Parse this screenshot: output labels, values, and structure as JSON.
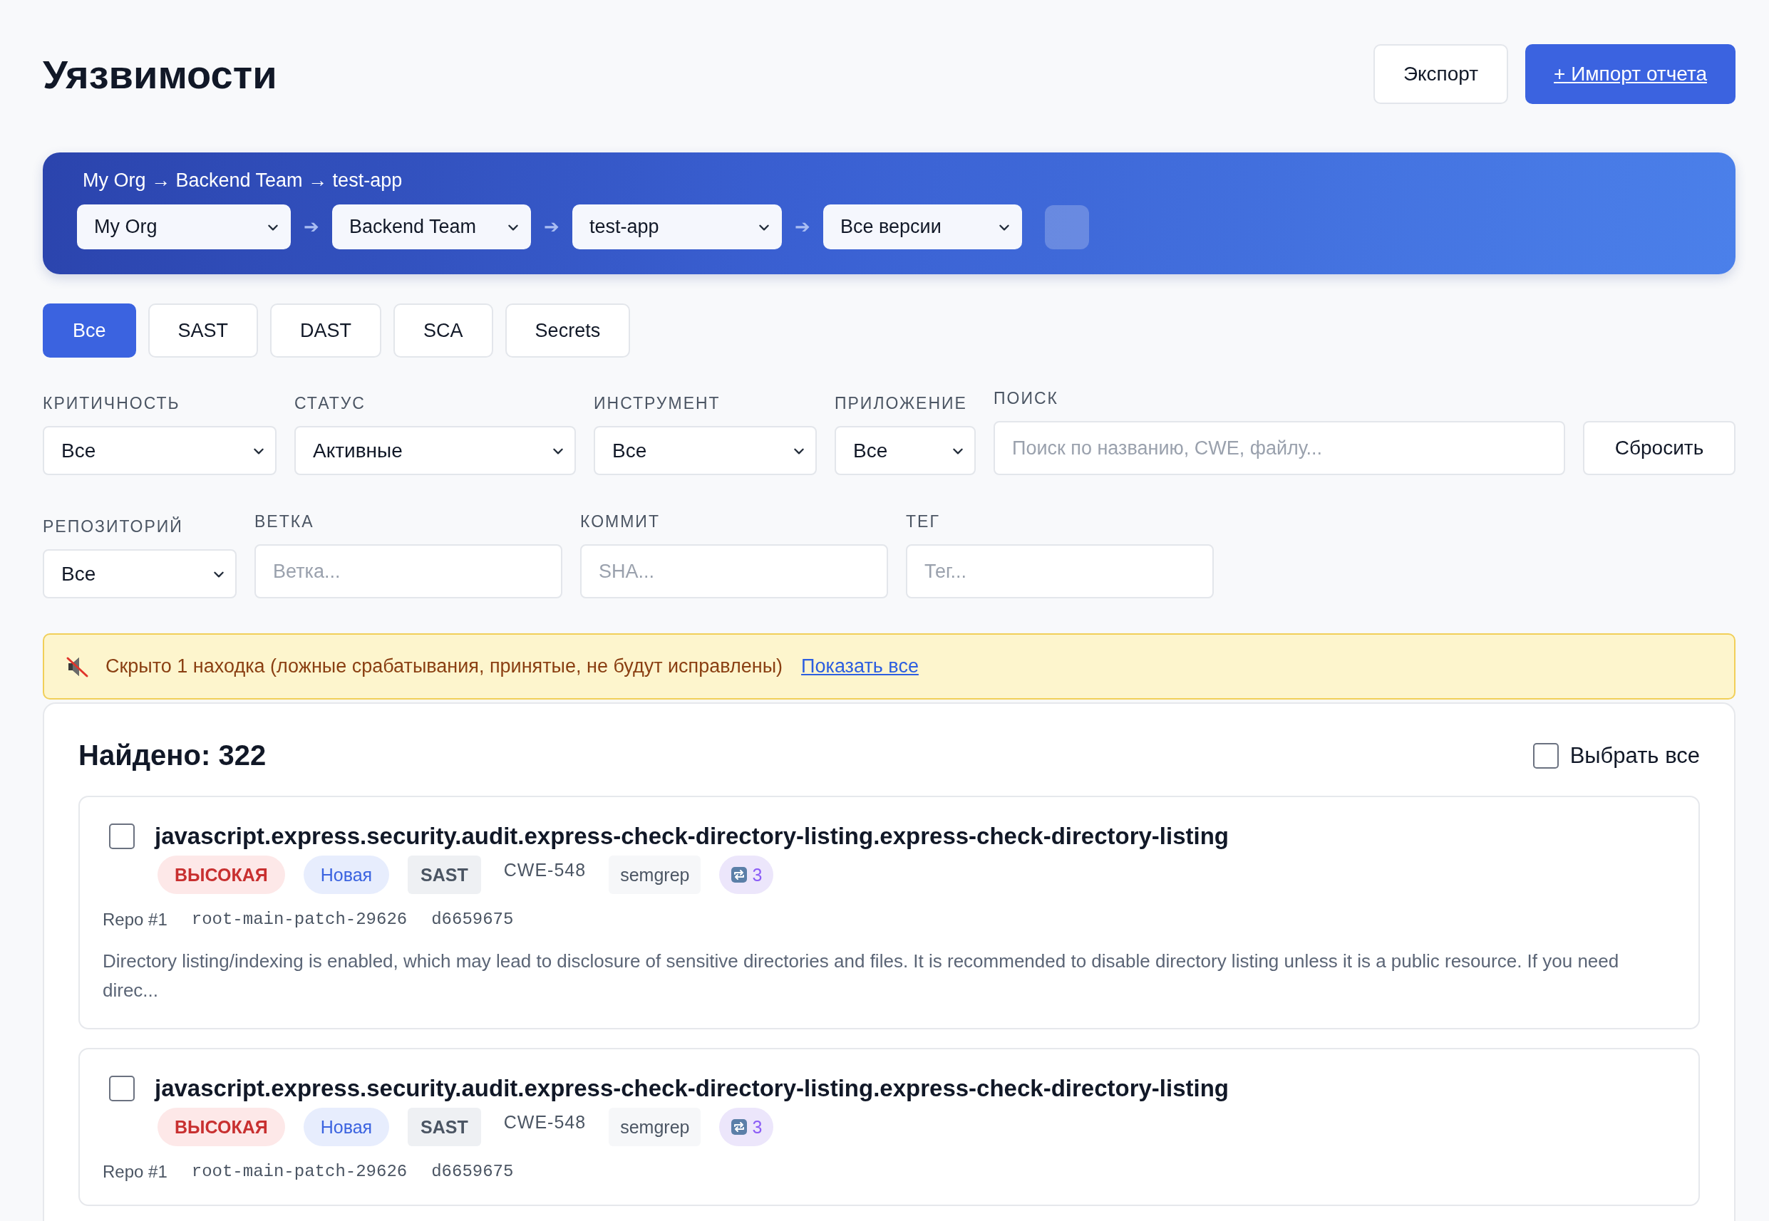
{
  "page_title": "Уязвимости",
  "header_buttons": [
    {
      "label": "Экспорт",
      "kind": "secondary"
    },
    {
      "label": "+ Импорт отчета",
      "kind": "primary"
    }
  ],
  "scope": {
    "breadcrumb": "My Org → Backend Team → test-app",
    "separator": "➔",
    "selects": [
      {
        "value": "My Org"
      },
      {
        "value": "Backend Team"
      },
      {
        "value": "test-app"
      },
      {
        "value": "Все версии"
      }
    ]
  },
  "tabs": [
    {
      "label": "Все",
      "selected": true
    },
    {
      "label": "SAST",
      "selected": false
    },
    {
      "label": "DAST",
      "selected": false
    },
    {
      "label": "SCA",
      "selected": false
    },
    {
      "label": "Secrets",
      "selected": false
    }
  ],
  "filter_rows": [
    [
      {
        "kind": "select",
        "label": "КРИТИЧНОСТЬ",
        "value": "Все"
      },
      {
        "kind": "select",
        "label": "СТАТУС",
        "value": "Активные"
      },
      {
        "kind": "select",
        "label": "ИНСТРУМЕНТ",
        "value": "Все"
      },
      {
        "kind": "select",
        "label": "ПРИЛОЖЕНИЕ",
        "value": "Все"
      },
      {
        "kind": "input",
        "label": "ПОИСК",
        "placeholder": "Поиск по названию, CWE, файлу..."
      },
      {
        "kind": "button",
        "label": "Сбросить"
      }
    ],
    [
      {
        "kind": "select",
        "label": "РЕПОЗИТОРИЙ",
        "value": "Все"
      },
      {
        "kind": "input",
        "label": "ВЕТКА",
        "placeholder": "Ветка..."
      },
      {
        "kind": "input",
        "label": "КОММИТ",
        "placeholder": "SHA..."
      },
      {
        "kind": "input",
        "label": "ТЕГ",
        "placeholder": "Тег..."
      }
    ]
  ],
  "notice": {
    "text": "Скрыто 1 находка (ложные срабатывания, принятые, не будут исправлены)",
    "link": "Показать все"
  },
  "results": {
    "count": "Найдено: 322",
    "select_all": {
      "label": "Выбрать все",
      "checked": false
    },
    "findings": [
      {
        "checked": false,
        "title": "javascript.express.security.audit.express-check-directory-listing.express-check-directory-listing",
        "severity": "ВЫСОКАЯ",
        "status": "Новая",
        "tool_type": "SAST",
        "cwe": "CWE-548",
        "scanner": "semgrep",
        "occurrences": "3",
        "repo": "Repo #1",
        "branch": "root-main-patch-29626",
        "commit": "d6659675",
        "description": "Directory listing/indexing is enabled, which may lead to disclosure of sensitive directories and files. It is recommended to disable directory listing unless it is a public resource. If you need direc..."
      },
      {
        "checked": false,
        "title": "javascript.express.security.audit.express-check-directory-listing.express-check-directory-listing",
        "severity": "ВЫСОКАЯ",
        "status": "Новая",
        "tool_type": "SAST",
        "cwe": "CWE-548",
        "scanner": "semgrep",
        "occurrences": "3",
        "repo": "Repo #1",
        "branch": "root-main-patch-29626",
        "commit": "d6659675"
      }
    ]
  }
}
